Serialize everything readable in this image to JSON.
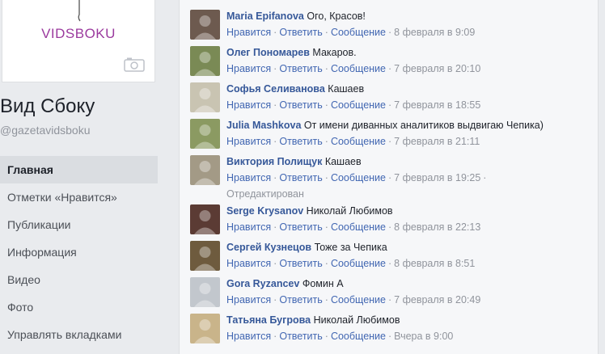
{
  "sidebar": {
    "cover_logo": "VIDSBOKU",
    "page_name": "Вид Сбоку",
    "page_handle": "@gazetavidsboku",
    "nav": [
      {
        "label": "Главная",
        "active": true
      },
      {
        "label": "Отметки «Нравится»",
        "active": false
      },
      {
        "label": "Публикации",
        "active": false
      },
      {
        "label": "Информация",
        "active": false
      },
      {
        "label": "Видео",
        "active": false
      },
      {
        "label": "Фото",
        "active": false
      },
      {
        "label": "Управлять вкладками",
        "active": false
      }
    ]
  },
  "comment_actions": {
    "like": "Нравится",
    "reply": "Ответить",
    "message": "Сообщение",
    "separator": "·"
  },
  "comments": [
    {
      "author": "Maria Epifanova",
      "text": "Ого, Красов!",
      "time": "8 февраля в 9:09",
      "avatar_color": "#6d5a4f"
    },
    {
      "author": "Олег Пономарев",
      "text": "Макаров.",
      "time": "7 февраля в 20:10",
      "avatar_color": "#7a8a55"
    },
    {
      "author": "Софья Селиванова",
      "text": "Кашаев",
      "time": "7 февраля в 18:55",
      "avatar_color": "#c9c4b2"
    },
    {
      "author": "Julia Mashkova",
      "text": "От имени диванных аналитиков выдвигаю Чепика)",
      "time": "7 февраля в 21:11",
      "avatar_color": "#8b9a62"
    },
    {
      "author": "Виктория Полищук",
      "text": "Кашаев",
      "time": "7 февраля в 19:25",
      "edited": "Отредактирован",
      "avatar_color": "#a39a86"
    },
    {
      "author": "Serge Krysanov",
      "text": "Николай Любимов",
      "time": "8 февраля в 22:13",
      "avatar_color": "#5b3b34"
    },
    {
      "author": "Сергей Кузнецов",
      "text": "Тоже за Чепика",
      "time": "8 февраля в 8:51",
      "avatar_color": "#6e5b3e"
    },
    {
      "author": "Gora Ryzancev",
      "text": "Фомин А",
      "time": "7 февраля в 20:49",
      "avatar_color": "#c2c7cd"
    },
    {
      "author": "Татьяна Бугрова",
      "text": "Николай Любимов",
      "time": "Вчера в 9:00",
      "avatar_color": "#c9b48a"
    }
  ]
}
